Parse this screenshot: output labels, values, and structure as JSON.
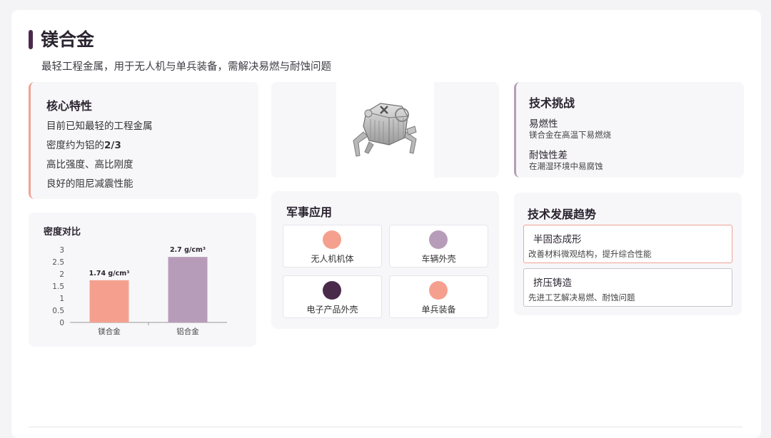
{
  "header": {
    "title": "镁合金",
    "subtitle": "最轻工程金属，用于无人机与单兵装备，需解决易燃与耐蚀问题"
  },
  "core": {
    "title": "核心特性",
    "items": [
      {
        "text": "目前已知最轻的工程金属",
        "strong": ""
      },
      {
        "text": "密度约为铝的",
        "strong": "2/3"
      },
      {
        "text": "高比强度、高比刚度",
        "strong": ""
      },
      {
        "text": "良好的阻尼减震性能",
        "strong": ""
      }
    ]
  },
  "chart_data": {
    "type": "bar",
    "title": "密度对比",
    "categories": [
      "镁合金",
      "铝合金"
    ],
    "values": [
      1.74,
      2.7
    ],
    "data_labels": [
      "1.74 g/cm³",
      "2.7 g/cm³"
    ],
    "colors": [
      "#f5a08f",
      "#b79cb9"
    ],
    "ylim": [
      0,
      3
    ],
    "yticks": [
      "0",
      "0.5",
      "1",
      "1.5",
      "2",
      "2.5",
      "3"
    ],
    "grid": false,
    "legend": "none"
  },
  "image": {
    "icon": "drone-icon"
  },
  "military": {
    "title": "军事应用",
    "items": [
      {
        "label": "无人机机体",
        "color": "#f5a08f"
      },
      {
        "label": "车辆外壳",
        "color": "#b79cb9"
      },
      {
        "label": "电子产品外壳",
        "color": "#4a2a4a"
      },
      {
        "label": "单兵装备",
        "color": "#f5a08f"
      }
    ]
  },
  "challenges": {
    "title": "技术挑战",
    "items": [
      {
        "name": "易燃性",
        "desc": "镁合金在高温下易燃烧"
      },
      {
        "name": "耐蚀性差",
        "desc": "在潮湿环境中易腐蚀"
      }
    ]
  },
  "trends": {
    "title": "技术发展趋势",
    "items": [
      {
        "name": "半固态成形",
        "desc": "改善材料微观结构，提升综合性能"
      },
      {
        "name": "挤压铸造",
        "desc": "先进工艺解决易燃、耐蚀问题"
      }
    ]
  },
  "colors": {
    "accent": "#4a2a4a",
    "coral": "#f5a08f",
    "mauve": "#b79cb9"
  }
}
